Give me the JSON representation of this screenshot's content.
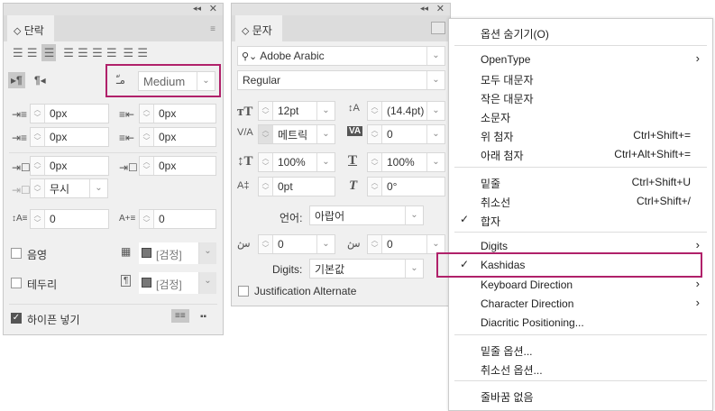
{
  "paragraph_panel": {
    "tab": "단락",
    "kashida": "Medium",
    "left_indent": "0px",
    "right_indent": "0px",
    "first_line_indent": "0px",
    "last_line_indent": "0px",
    "space_before": "0px",
    "space_after": "0px",
    "align_to_grid": "무시",
    "drop_cap_lines": "0",
    "drop_cap_chars": "0",
    "shading_label": "음영",
    "shading_color": "[검정]",
    "border_label": "테두리",
    "border_color": "[검정]",
    "hyphenate_label": "하이픈 넣기",
    "hyphenate_checked": true
  },
  "character_panel": {
    "tab": "문자",
    "font_family": "Adobe Arabic",
    "font_style": "Regular",
    "font_size": "12pt",
    "leading": "(14.4pt)",
    "kerning": "메트릭",
    "tracking": "0",
    "vertical_scale": "100%",
    "horizontal_scale": "100%",
    "baseline_shift": "0pt",
    "skew": "0°",
    "language_label": "언어:",
    "language": "아랍어",
    "diacritic_x": "0",
    "diacritic_y": "0",
    "digits_label": "Digits:",
    "digits": "기본값",
    "justification_alternate": "Justification Alternate"
  },
  "menu": {
    "items": [
      {
        "label": "옵션 숨기기(O)"
      },
      {
        "label": "OpenType",
        "submenu": true
      },
      {
        "label": "모두 대문자"
      },
      {
        "label": "작은 대문자"
      },
      {
        "label": "소문자"
      },
      {
        "label": "위 첨자",
        "shortcut": "Ctrl+Shift+="
      },
      {
        "label": "아래 첨자",
        "shortcut": "Ctrl+Alt+Shift+="
      },
      {
        "label": "밑줄",
        "shortcut": "Ctrl+Shift+U"
      },
      {
        "label": "취소선",
        "shortcut": "Ctrl+Shift+/"
      },
      {
        "label": "합자",
        "checked": true
      },
      {
        "label": "Digits",
        "submenu": true
      },
      {
        "label": "Kashidas",
        "checked": true
      },
      {
        "label": "Keyboard Direction",
        "submenu": true
      },
      {
        "label": "Character Direction",
        "submenu": true
      },
      {
        "label": "Diacritic Positioning..."
      },
      {
        "label": "밑줄 옵션..."
      },
      {
        "label": "취소선 옵션..."
      },
      {
        "label": "줄바꿈 없음"
      }
    ],
    "check": "✓",
    "arrow": "›"
  },
  "highlight_color": "#b0216a"
}
